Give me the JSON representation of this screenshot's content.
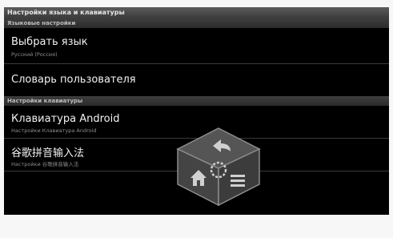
{
  "window": {
    "title": "Настройки языка и клавиатуры"
  },
  "sections": [
    {
      "header": "Языковые настройки",
      "items": [
        {
          "title": "Выбрать язык",
          "summary": "Русский (Россия)"
        },
        {
          "title": "Словарь пользователя",
          "summary": ""
        }
      ]
    },
    {
      "header": "Настройки клавиатуры",
      "items": [
        {
          "title": "Клавиатура Android",
          "summary": "Настройки Клавиатура Android"
        },
        {
          "title": "谷歌拼音输入法",
          "summary": "Настройки 谷歌拼音输入法"
        }
      ]
    }
  ],
  "overlay": {
    "name": "navigation-cube",
    "icons": [
      "back-arrow-icon",
      "home-icon",
      "menu-icon",
      "center-ring-icon"
    ],
    "face_color": "#4a4a4a",
    "edge_color": "#8a8a8a"
  }
}
